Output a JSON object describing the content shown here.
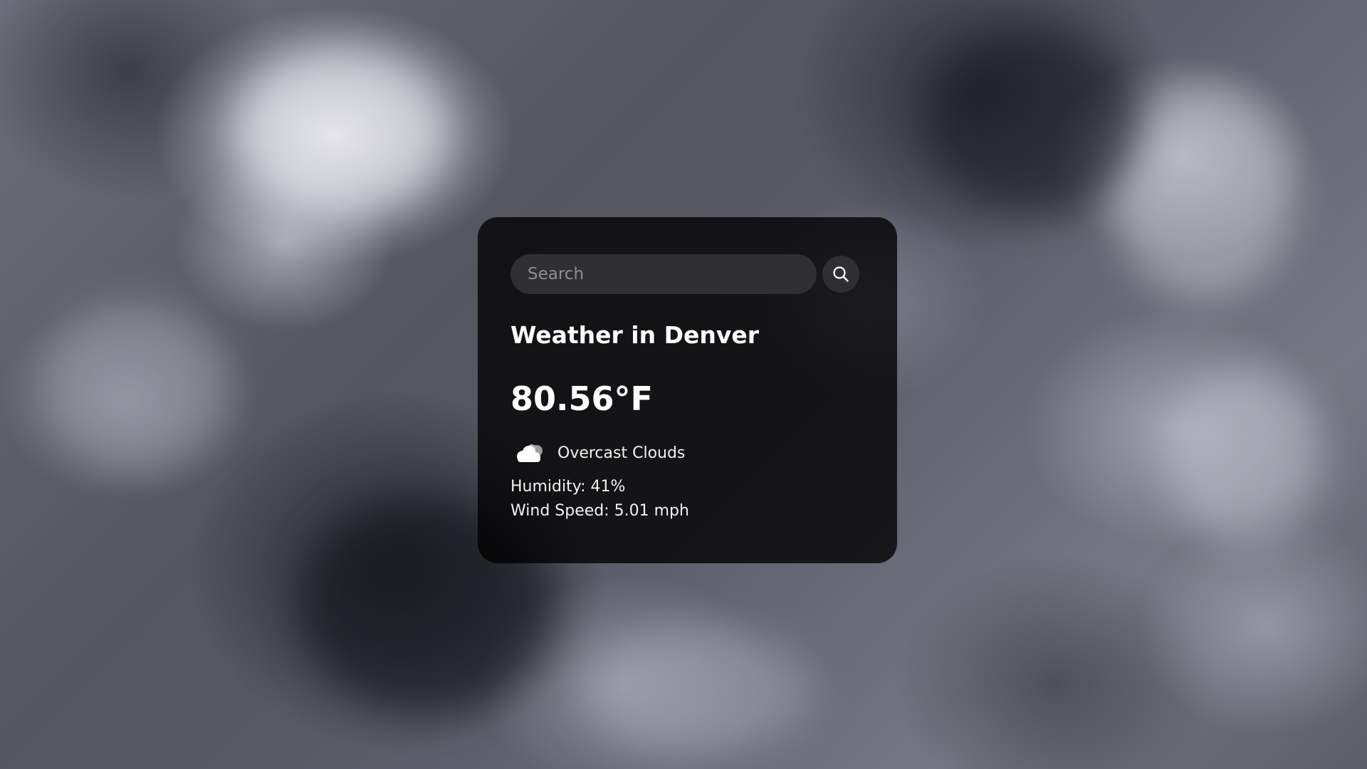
{
  "search": {
    "placeholder": "Search",
    "value": ""
  },
  "weather": {
    "title": "Weather in Denver",
    "temperature": "80.56°F",
    "condition": "Overcast Clouds",
    "condition_icon": "cloud-icon",
    "humidity": "Humidity: 41%",
    "wind_speed": "Wind Speed: 5.01 mph"
  },
  "colors": {
    "card_background": "#000000",
    "input_background": "#2f2f31",
    "text": "#ffffff",
    "placeholder": "#8f8f92"
  }
}
